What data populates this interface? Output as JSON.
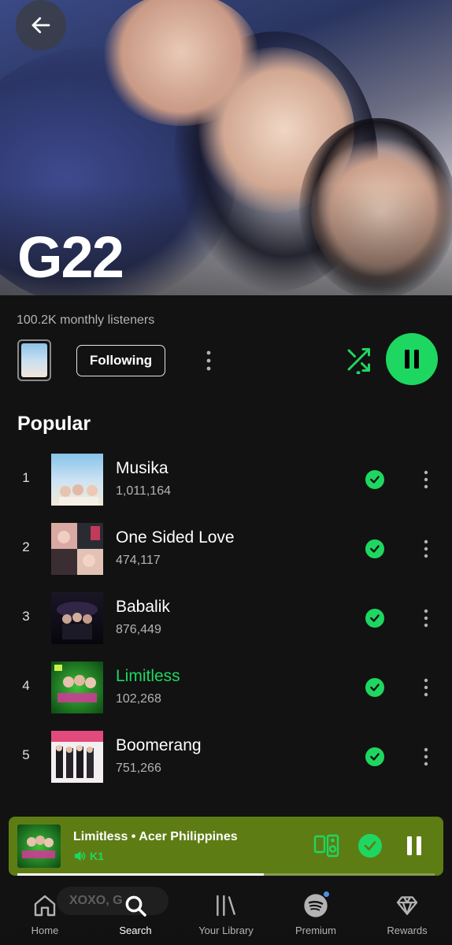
{
  "artist": {
    "name": "G22",
    "monthly_listeners": "100.2K monthly listeners",
    "follow_label": "Following"
  },
  "icons": {
    "back": "arrow-left-icon",
    "more": "more-vertical-icon",
    "shuffle": "shuffle-icon",
    "play_state": "pause-icon",
    "saved": "check-circle-icon"
  },
  "popular": {
    "title": "Popular",
    "tracks": [
      {
        "num": "1",
        "title": "Musika",
        "plays": "1,011,164",
        "active": false
      },
      {
        "num": "2",
        "title": "One Sided Love",
        "plays": "474,117",
        "active": false
      },
      {
        "num": "3",
        "title": "Babalik",
        "plays": "876,449",
        "active": false
      },
      {
        "num": "4",
        "title": "Limitless",
        "plays": "102,268",
        "active": true
      },
      {
        "num": "5",
        "title": "Boomerang",
        "plays": "751,266",
        "active": false
      }
    ]
  },
  "now_playing": {
    "title": "Limitless • Acer Philippines",
    "device": "K1",
    "progress": 0.59
  },
  "ghost_search": "XOXO, G",
  "nav": [
    {
      "label": "Home",
      "icon": "home-icon",
      "active": false
    },
    {
      "label": "Search",
      "icon": "search-icon",
      "active": true
    },
    {
      "label": "Your Library",
      "icon": "library-icon",
      "active": false
    },
    {
      "label": "Premium",
      "icon": "spotify-logo-icon",
      "active": false
    },
    {
      "label": "Rewards",
      "icon": "diamond-icon",
      "active": false
    }
  ],
  "colors": {
    "accent": "#1ed760",
    "background": "#121212",
    "mini_player": "#5e7c14"
  }
}
